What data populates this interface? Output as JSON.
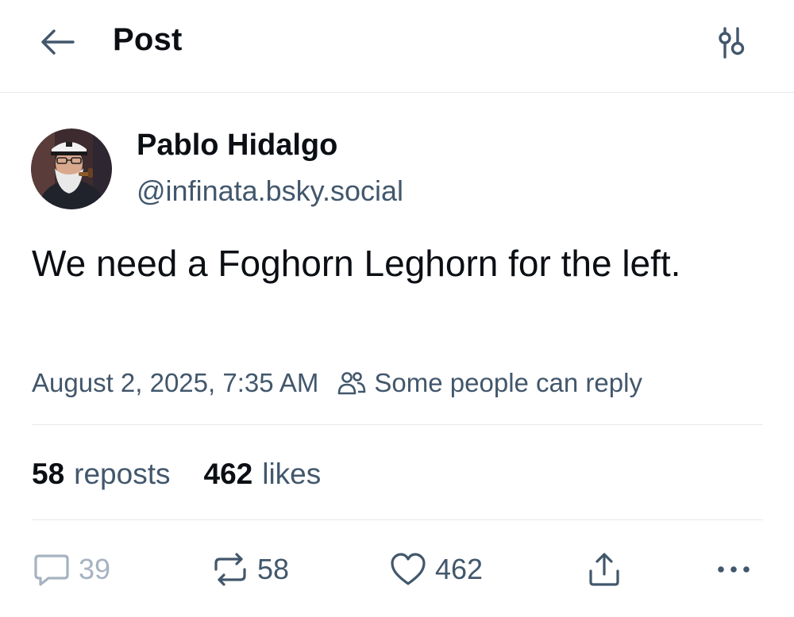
{
  "header": {
    "title": "Post",
    "back_icon": "arrow-left-icon",
    "settings_icon": "sliders-icon"
  },
  "post": {
    "author": {
      "display_name": "Pablo Hidalgo",
      "handle": "@infinata.bsky.social"
    },
    "text": "We need a Foghorn Leghorn for the left.",
    "timestamp": "August 2, 2025, 7:35 AM",
    "reply_setting": "Some people can reply",
    "stats": {
      "reposts_count": "58",
      "reposts_label": "reposts",
      "likes_count": "462",
      "likes_label": "likes"
    },
    "actions": {
      "reply_count": "39",
      "repost_count": "58",
      "like_count": "462"
    }
  },
  "colors": {
    "text_primary": "#0b0f14",
    "text_secondary": "#42576c",
    "text_muted": "#a6b3c0",
    "divider": "#e6e9ed",
    "background": "#ffffff"
  }
}
